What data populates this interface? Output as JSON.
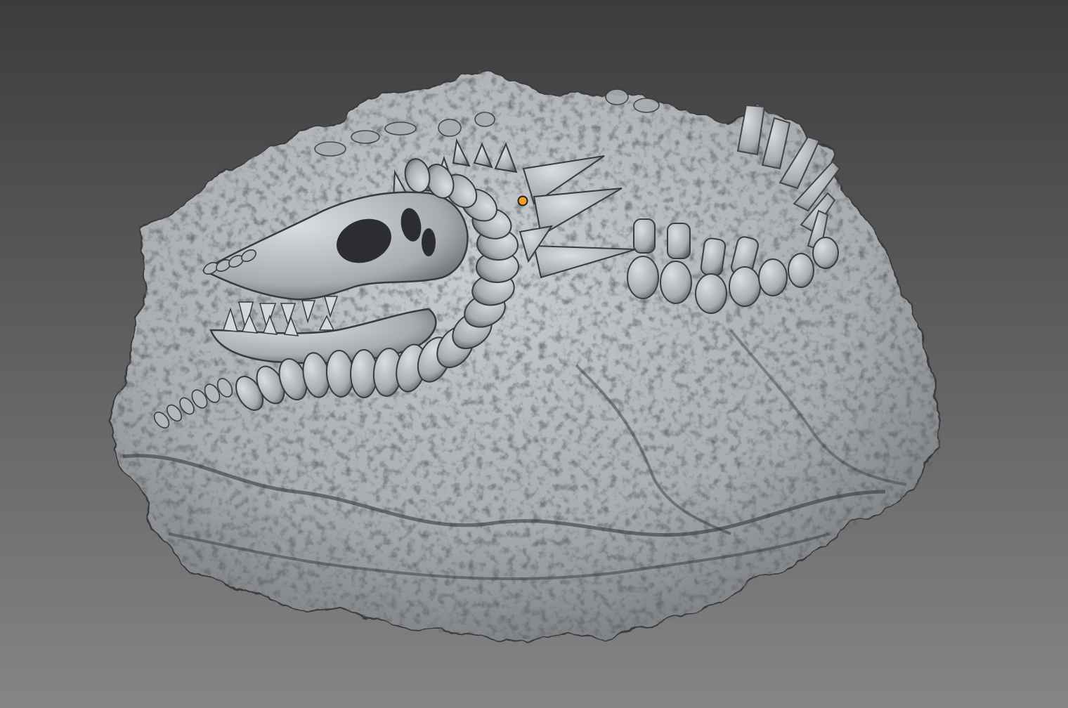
{
  "viewport": {
    "background_top": "#3c3c3c",
    "background_bottom": "#858585",
    "mesh_color": "#b9bdc2",
    "mesh_shadow": "#2a2a2a",
    "pivot_color": "#f0a020",
    "icons": {
      "pivot": "object-origin-icon"
    }
  }
}
